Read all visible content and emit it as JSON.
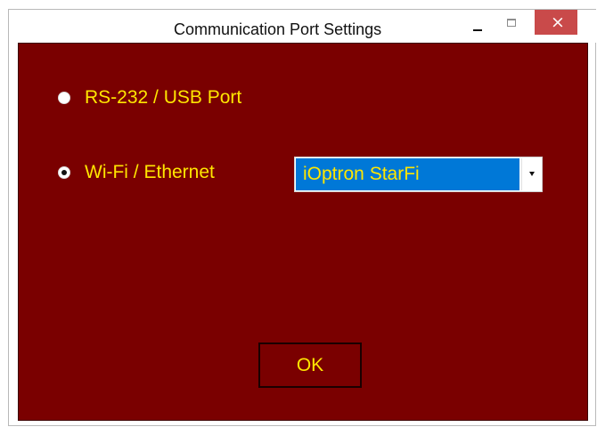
{
  "window": {
    "title": "Communication Port Settings",
    "buttons": {
      "minimize_icon": "minimize-icon",
      "maximize_icon": "maximize-icon",
      "close_icon": "close-icon"
    }
  },
  "colors": {
    "client_background": "#7a0000",
    "label_text": "#ffe600",
    "dropdown_selection": "#0078d7",
    "close_button": "#c94a4a"
  },
  "connection": {
    "options": [
      {
        "label": "RS-232 / USB Port",
        "selected": false
      },
      {
        "label": "Wi-Fi / Ethernet",
        "selected": true
      }
    ],
    "device_select": {
      "selected_value": "iOptron StarFi"
    }
  },
  "actions": {
    "ok_label": "OK"
  }
}
